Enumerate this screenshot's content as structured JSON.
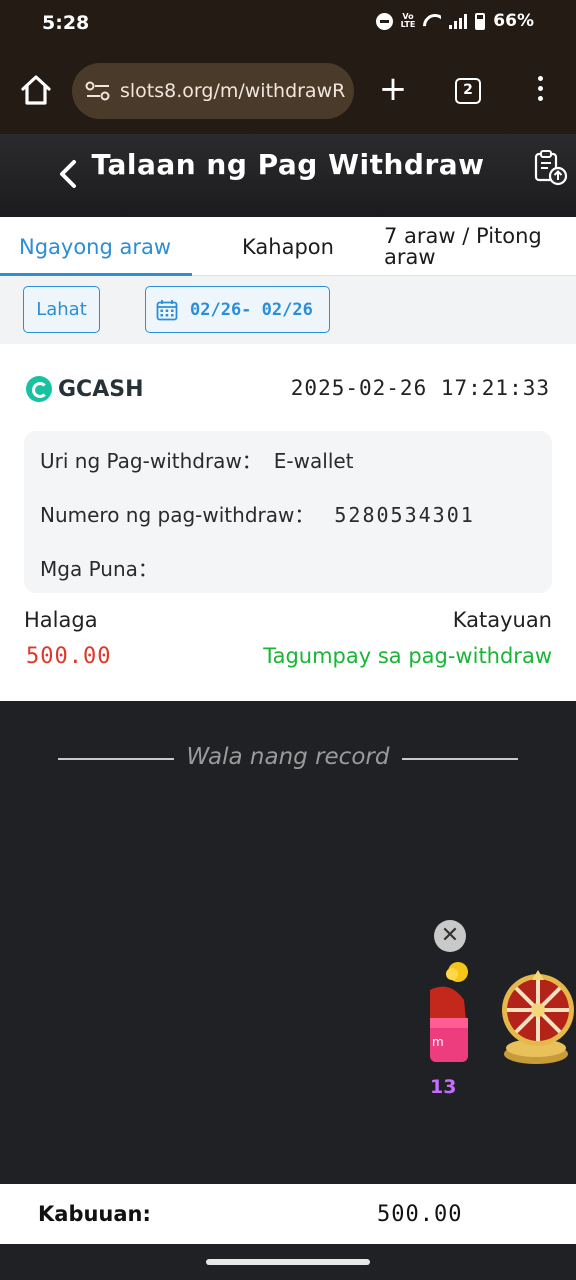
{
  "status_bar": {
    "time": "5:28",
    "volte_label": "VoLTE",
    "battery": "66%"
  },
  "browser": {
    "url": "slots8.org/m/withdrawR",
    "tab_count": "2",
    "plus_label": "+"
  },
  "header": {
    "title": "Talaan ng Pag Withdraw"
  },
  "tabs": [
    {
      "label": "Ngayong araw"
    },
    {
      "label": "Kahapon"
    },
    {
      "label": "7 araw / Pitong araw"
    }
  ],
  "filters": {
    "all_label": "Lahat",
    "date_range": "02/26- 02/26"
  },
  "record": {
    "method": "GCASH",
    "datetime": "2025-02-26 17:21:33",
    "type_label": "Uri ng Pag-withdraw：",
    "type_value": "E-wallet",
    "number_label": "Numero ng pag-withdraw：",
    "number_value": "5280534301",
    "remarks_label": "Mga Puna：",
    "remarks_value": "",
    "amount_label": "Halaga",
    "amount_value": "500.00",
    "status_label": "Katayuan",
    "status_value": "Tagumpay sa pag-withdraw"
  },
  "no_more_text": "Wala nang record",
  "promo": {
    "close_label": "✕",
    "counter": "13"
  },
  "footer": {
    "total_label": "Kabuuan:",
    "total_value": "500.00"
  },
  "colors": {
    "accent": "#2b8ed6",
    "amount": "#e0372b",
    "success": "#19b635",
    "browser_bg": "#241b14"
  }
}
